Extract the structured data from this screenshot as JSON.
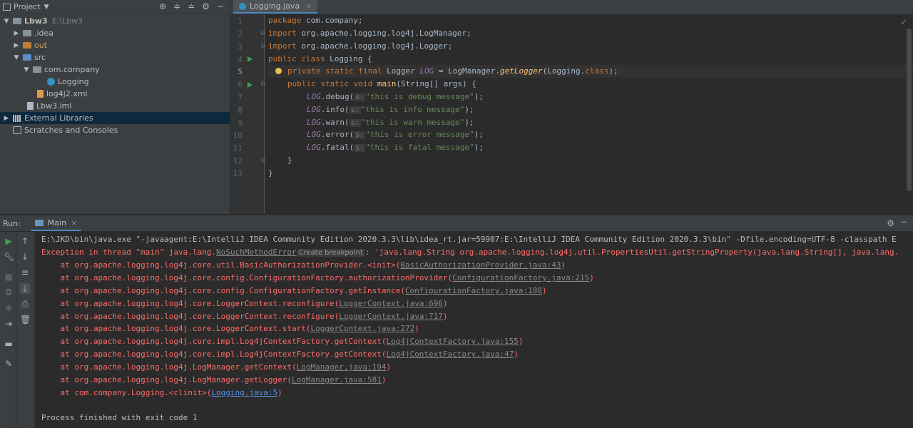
{
  "project": {
    "title": "Project",
    "tree": [
      {
        "label": "Lbw3",
        "hint": "E:\\Lbw3"
      },
      {
        "label": ".idea"
      },
      {
        "label": "out"
      },
      {
        "label": "src"
      },
      {
        "label": "com.company"
      },
      {
        "label": "Logging"
      },
      {
        "label": "log4j2.xml"
      },
      {
        "label": "Lbw3.iml"
      },
      {
        "label": "External Libraries"
      },
      {
        "label": "Scratches and Consoles"
      }
    ]
  },
  "editor": {
    "tab": "Logging.java",
    "line_numbers": [
      "1",
      "2",
      "3",
      "4",
      "5",
      "6",
      "7",
      "8",
      "9",
      "10",
      "11",
      "12",
      "13"
    ],
    "lines": {
      "l1_kw": "package",
      "l1_rest": " com.company;",
      "l2_kw": "import",
      "l2_rest": " org.apache.logging.log4j.LogManager;",
      "l3_kw": "import",
      "l3_rest": " org.apache.logging.log4j.Logger;",
      "l4_kw": "public class",
      "l4_rest": " Logging {",
      "l5_kw": "private static final",
      "l5_type": " Logger ",
      "l5_field": "LOG",
      "l5_eq": " = LogManager.",
      "l5_meth": "getLogger",
      "l5_rest": "(Logging.",
      "l5_kw2": "class",
      "l5_end": ");",
      "l6_kw": "public static void",
      "l6_meth": " main",
      "l6_rest": "(String[] args) {",
      "log_field": "LOG",
      "hint_s": "s:",
      "l7_call": ".debug(",
      "l7_str": "\"this is debug message\"",
      "l7_end": ");",
      "l8_call": ".info(",
      "l8_str": "\"this is info message\"",
      "l8_end": ");",
      "l9_call": ".warn(",
      "l9_str": "\"this is warn message\"",
      "l9_end": ");",
      "l10_call": ".error(",
      "l10_str": "\"this is error message\"",
      "l10_end": ");",
      "l11_call": ".fatal(",
      "l11_str": "\"this is fatal message\"",
      "l11_end": ");",
      "l12": "}",
      "l13": "}"
    }
  },
  "run": {
    "label": "Run:",
    "tab": "Main",
    "console": {
      "cmd": "E:\\JKD\\bin\\java.exe \"-javaagent:E:\\IntelliJ IDEA Community Edition 2020.3.3\\lib\\idea_rt.jar=59907:E:\\IntelliJ IDEA Community Edition 2020.3.3\\bin\" -Dfile.encoding=UTF-8 -classpath E",
      "exc_prefix": "Exception in thread \"main\" java.lang.",
      "exc_class": "NoSuchMethodError",
      "exc_bp": "Create breakpoint",
      "exc_rest": ": 'java.lang.String org.apache.logging.log4j.util.PropertiesUtil.getStringProperty(java.lang.String[], java.lang.",
      "stack": [
        {
          "at": "    at org.apache.logging.log4j.core.util.BasicAuthorizationProvider.<init>(",
          "src": "BasicAuthorizationProvider.java:43",
          "end": ")"
        },
        {
          "at": "    at org.apache.logging.log4j.core.config.ConfigurationFactory.authorizationProvider(",
          "src": "ConfigurationFactory.java:215",
          "end": ")"
        },
        {
          "at": "    at org.apache.logging.log4j.core.config.ConfigurationFactory.getInstance(",
          "src": "ConfigurationFactory.java:188",
          "end": ")"
        },
        {
          "at": "    at org.apache.logging.log4j.core.LoggerContext.reconfigure(",
          "src": "LoggerContext.java:696",
          "end": ")"
        },
        {
          "at": "    at org.apache.logging.log4j.core.LoggerContext.reconfigure(",
          "src": "LoggerContext.java:717",
          "end": ")"
        },
        {
          "at": "    at org.apache.logging.log4j.core.LoggerContext.start(",
          "src": "LoggerContext.java:272",
          "end": ")"
        },
        {
          "at": "    at org.apache.logging.log4j.core.impl.Log4jContextFactory.getContext(",
          "src": "Log4jContextFactory.java:155",
          "end": ")"
        },
        {
          "at": "    at org.apache.logging.log4j.core.impl.Log4jContextFactory.getContext(",
          "src": "Log4jContextFactory.java:47",
          "end": ")"
        },
        {
          "at": "    at org.apache.logging.log4j.LogManager.getContext(",
          "src": "LogManager.java:194",
          "end": ")"
        },
        {
          "at": "    at org.apache.logging.log4j.LogManager.getLogger(",
          "src": "LogManager.java:581",
          "end": ")"
        },
        {
          "at": "    at com.company.Logging.<clinit>(",
          "src": "Logging.java:5",
          "end": ")"
        }
      ],
      "finished": "Process finished with exit code 1"
    }
  }
}
